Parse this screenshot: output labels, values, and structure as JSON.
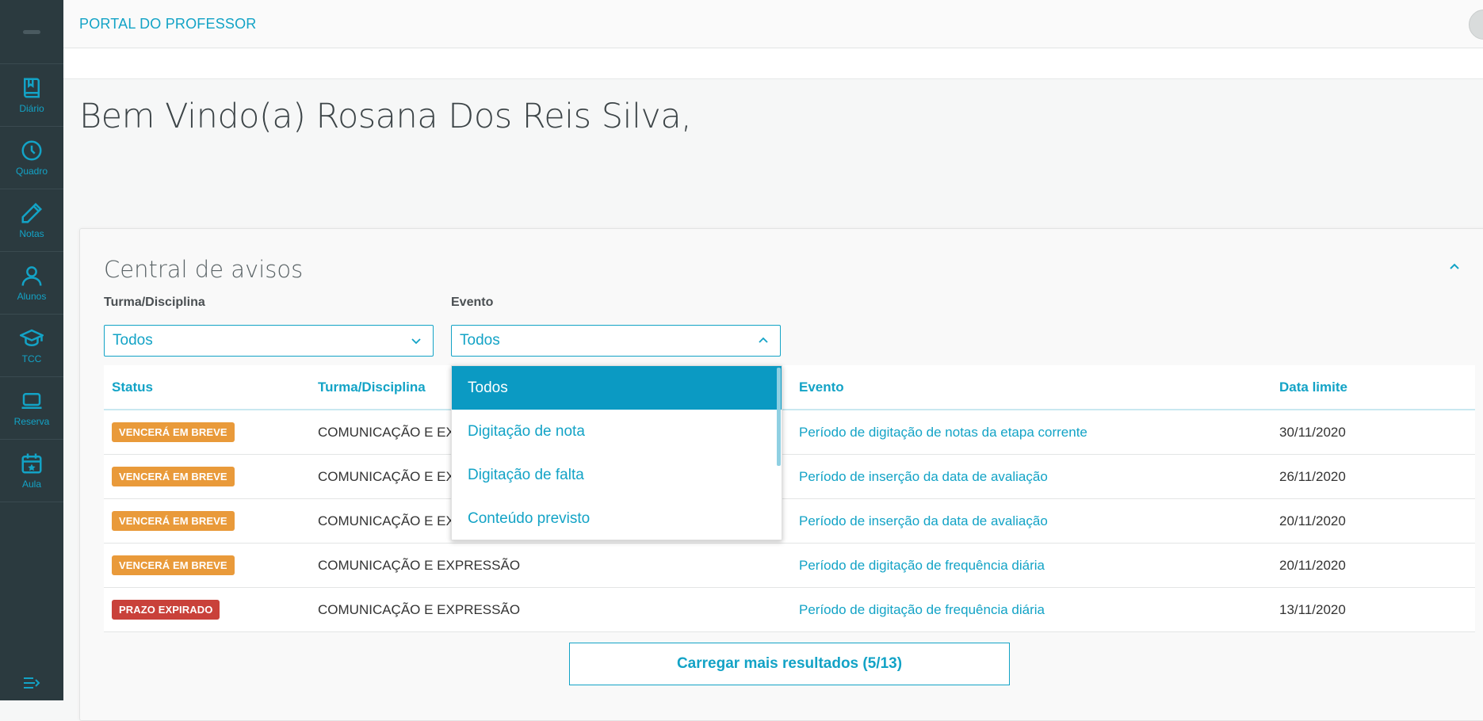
{
  "header": {
    "title": "PORTAL DO PROFESSOR"
  },
  "sidebar": {
    "items": [
      {
        "label": "Diário",
        "icon": "book-icon"
      },
      {
        "label": "Quadro",
        "icon": "clock-icon"
      },
      {
        "label": "Notas",
        "icon": "pencil-icon"
      },
      {
        "label": "Alunos",
        "icon": "user-icon"
      },
      {
        "label": "TCC",
        "icon": "graduation-cap-icon"
      },
      {
        "label": "Reserva",
        "icon": "laptop-icon"
      },
      {
        "label": "Aula",
        "icon": "calendar-star-icon"
      }
    ],
    "collapse_icon": "menu-collapse-icon"
  },
  "welcome": "Bem Vindo(a) Rosana Dos Reis Silva,",
  "card": {
    "title": "Central de avisos",
    "filters": {
      "turma_label": "Turma/Disciplina",
      "turma_value": "Todos",
      "evento_label": "Evento",
      "evento_value": "Todos"
    },
    "dropdown_options": [
      "Todos",
      "Digitação de nota",
      "Digitação de falta",
      "Conteúdo previsto"
    ],
    "table": {
      "headers": [
        "Status",
        "Turma/Disciplina",
        "Evento",
        "Data limite"
      ],
      "rows": [
        {
          "status": "VENCERÁ EM BREVE",
          "turma": "COMUNICAÇÃO E EX",
          "evento": "Período de digitação de notas da etapa corrente",
          "data": "30/11/2020"
        },
        {
          "status": "VENCERÁ EM BREVE",
          "turma": "COMUNICAÇÃO E EX",
          "evento": "Período de inserção da data de avaliação",
          "data": "26/11/2020"
        },
        {
          "status": "VENCERÁ EM BREVE",
          "turma": "COMUNICAÇÃO E EX",
          "evento": "Período de inserção da data de avaliação",
          "data": "20/11/2020"
        },
        {
          "status": "VENCERÁ EM BREVE",
          "turma": "COMUNICAÇÃO E EXPRESSÃO",
          "evento": "Período de digitação de frequência diária",
          "data": "20/11/2020"
        },
        {
          "status": "PRAZO EXPIRADO",
          "turma": "COMUNICAÇÃO E EXPRESSÃO",
          "evento": "Período de digitação de frequência diária",
          "data": "13/11/2020"
        }
      ]
    },
    "load_more": "Carregar mais resultados (5/13)"
  },
  "colors": {
    "accent": "#13a3c6",
    "sidebar": "#2b3a3f",
    "warning": "#e99a3a",
    "expired": "#c9413a"
  }
}
